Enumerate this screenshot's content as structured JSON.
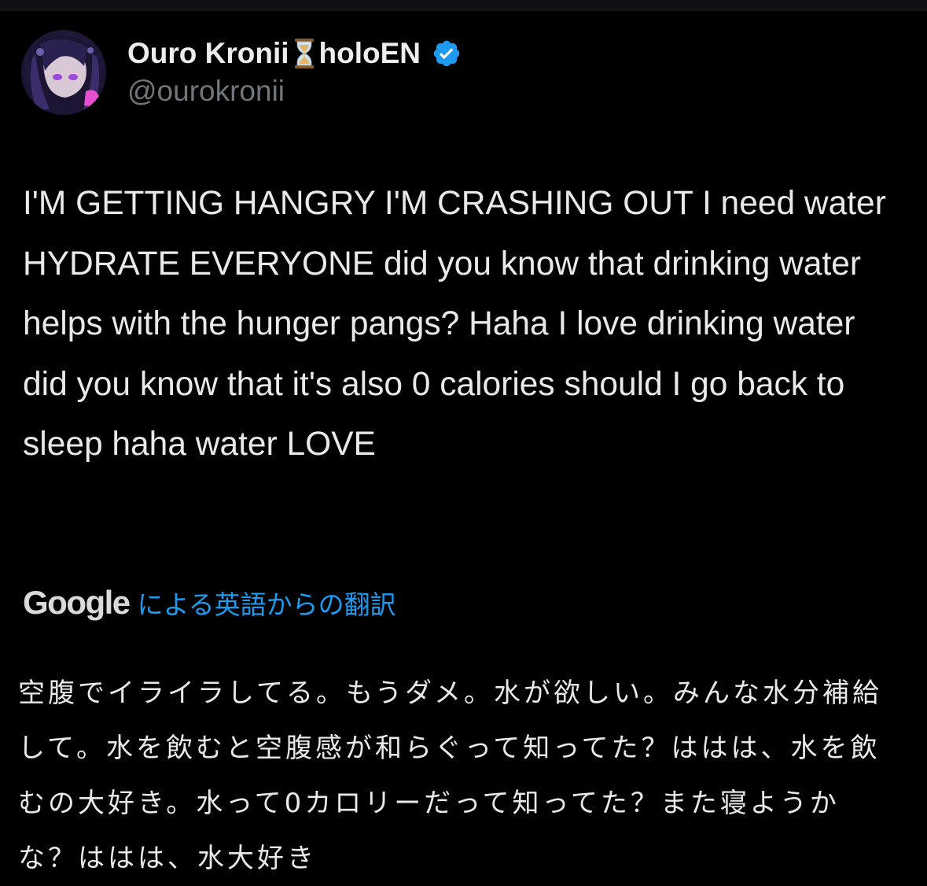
{
  "author": {
    "display_name": "Ouro Kronii",
    "name_suffix": "holoEN",
    "handle": "@ourokronii",
    "name_emoji_icon": "hourglass-icon",
    "verified_icon": "verified-badge-icon",
    "verified_color": "#1d9bf0"
  },
  "tweet": {
    "text": "I'M GETTING HANGRY I'M CRASHING OUT I need water HYDRATE EVERYONE did you know that drinking water helps with the hunger pangs? Haha I love drinking water did you know that it's also 0 calories should I go back to sleep haha water LOVE"
  },
  "translation": {
    "provider": "Google",
    "label": "による英語からの翻訳",
    "label_color": "#1d9bf0",
    "text": "空腹でイライラしてる。もうダメ。水が欲しい。みんな水分補給して。水を飲むと空腹感が和らぐって知ってた？ははは、水を飲むの大好き。水って0カロリーだって知ってた？また寝ようかな？ははは、水大好き"
  },
  "colors": {
    "background": "#000000",
    "text_primary": "#e7e9ea",
    "text_secondary": "#71767b"
  }
}
